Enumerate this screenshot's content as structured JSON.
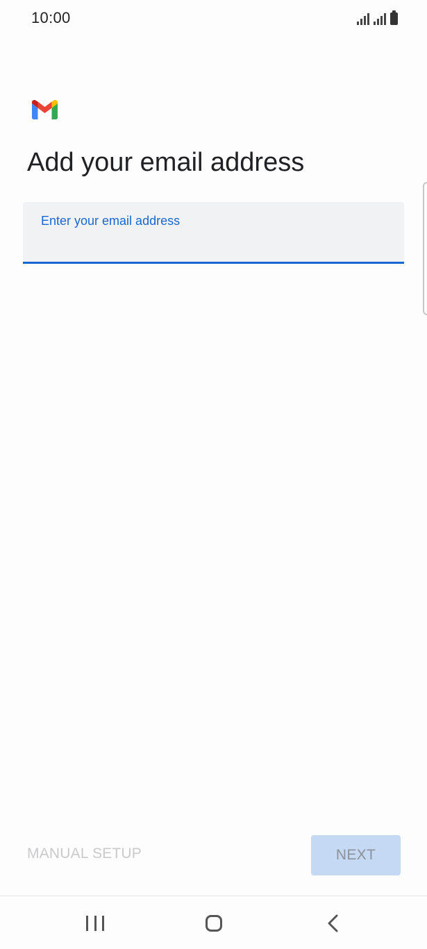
{
  "status_bar": {
    "time": "10:00",
    "icons": [
      "signal-icon",
      "signal-icon",
      "battery-icon"
    ]
  },
  "logo": {
    "name": "gmail-logo-icon",
    "colors": {
      "blue": "#4285f4",
      "red": "#ea4335",
      "yellow": "#fbbc04",
      "green": "#34a853",
      "dark_red": "#c5221f"
    }
  },
  "page": {
    "title": "Add your email address"
  },
  "email_field": {
    "label": "Enter your email address",
    "value": "",
    "accent_color": "#1967d2"
  },
  "actions": {
    "manual_setup_label": "MANUAL SETUP",
    "next_label": "NEXT"
  },
  "nav_bar": {
    "icons": [
      "recents-icon",
      "home-icon",
      "back-icon"
    ]
  }
}
